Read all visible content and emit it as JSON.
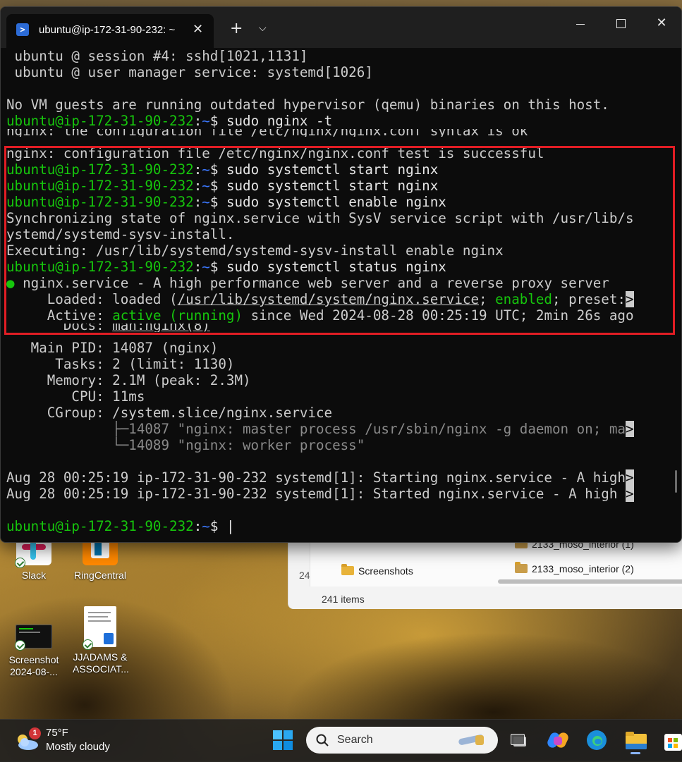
{
  "terminal": {
    "tab_title": "ubuntu@ip-172-31-90-232: ~",
    "prompt_user_host": "ubuntu@ip-172-31-90-232",
    "prompt_path": "~",
    "prompt_sign": "$",
    "lines": {
      "l1": " ubuntu @ session #4: sshd[1021,1131]",
      "l2": " ubuntu @ user manager service: systemd[1026]",
      "l4": "No VM guests are running outdated hypervisor (qemu) binaries on this host.",
      "cmd1": " sudo nginx -t",
      "l6": "nginx: the configuration file /etc/nginx/nginx.conf syntax is ok",
      "l7": "nginx: configuration file /etc/nginx/nginx.conf test is successful",
      "cmd2": " sudo systemctl start nginx",
      "cmd3": " sudo systemctl start nginx",
      "cmd4": " sudo systemctl enable nginx",
      "l11": "Synchronizing state of nginx.service with SysV service script with /usr/lib/s",
      "l12": "ystemd/systemd-sysv-install.",
      "l13": "Executing: /usr/lib/systemd/systemd-sysv-install enable nginx",
      "cmd5": " sudo systemctl status nginx",
      "svc_bullet": "●",
      "svc_desc": " nginx.service - A high performance web server and a reverse proxy server",
      "loaded_label": "     Loaded: loaded (",
      "loaded_path": "/usr/lib/systemd/system/nginx.service",
      "loaded_sep": "; ",
      "loaded_enabled": "enabled",
      "loaded_rest": "; preset:",
      "trunc": ">",
      "active_label": "     Active: ",
      "active_state": "active (running)",
      "active_rest": " since Wed 2024-08-28 00:25:19 UTC; 2min 26s ago",
      "docs_label": "       Docs: ",
      "docs_val": "man:nginx(8)",
      "pid": "   Main PID: 14087 (nginx)",
      "tasks": "      Tasks: 2 (limit: 1130)",
      "memory": "     Memory: 2.1M (peak: 2.3M)",
      "cpu": "        CPU: 11ms",
      "cgroup": "     CGroup: /system.slice/nginx.service",
      "tree1_prefix": "             ├─",
      "tree1": "14087 \"nginx: master process /usr/sbin/nginx -g daemon on; ma",
      "tree2_prefix": "             └─",
      "tree2": "14089 \"nginx: worker process\"",
      "log1": "Aug 28 00:25:19 ip-172-31-90-232 systemd[1]: Starting nginx.service - A high",
      "log2": "Aug 28 00:25:19 ip-172-31-90-232 systemd[1]: Started nginx.service - A high ",
      "cursor": " |"
    }
  },
  "desktop": {
    "icons": [
      {
        "label1": "Slack",
        "label2": ""
      },
      {
        "label1": "RingCentral",
        "label2": ""
      },
      {
        "label1": "Screenshot",
        "label2": "2024-08-..."
      },
      {
        "label1": "JJADAMS &",
        "label2": "ASSOCIAT..."
      }
    ],
    "explorer": {
      "folder": "Screenshots",
      "file1": "2133_moso_interior (1)",
      "file2": "2133_moso_interior (2)",
      "partial": "24",
      "items": "241 items"
    }
  },
  "taskbar": {
    "temp": "75°F",
    "condition": "Mostly cloudy",
    "badge": "1",
    "search_label": "Search"
  }
}
